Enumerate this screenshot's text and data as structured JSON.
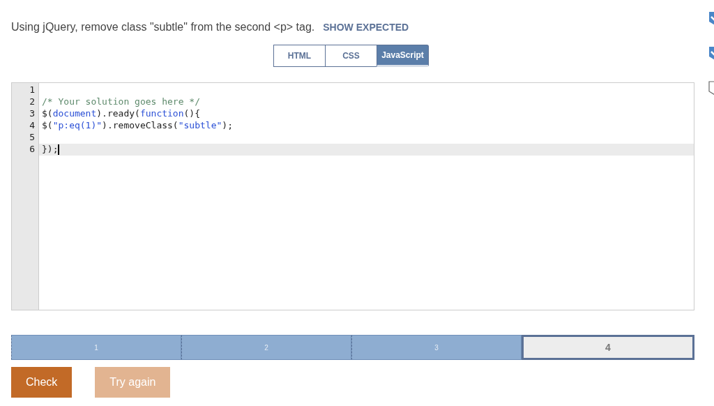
{
  "instruction": "Using jQuery, remove class \"subtle\" from the second <p> tag.",
  "show_expected": "SHOW EXPECTED",
  "tabs": [
    {
      "label": "HTML",
      "selected": false
    },
    {
      "label": "CSS",
      "selected": false
    },
    {
      "label": "JavaScript",
      "selected": true
    }
  ],
  "editor": {
    "lines": [
      {
        "number": "1",
        "current": false
      },
      {
        "number": "2",
        "current": false,
        "tokens": [
          {
            "text": "/* Your solution goes here */",
            "kind": "comment"
          }
        ]
      },
      {
        "number": "3",
        "current": false,
        "tokens": [
          {
            "text": "$(",
            "kind": "plain"
          },
          {
            "text": "document",
            "kind": "keyword"
          },
          {
            "text": ").ready(",
            "kind": "plain"
          },
          {
            "text": "function",
            "kind": "keyword"
          },
          {
            "text": "(){",
            "kind": "plain"
          }
        ]
      },
      {
        "number": "4",
        "current": false,
        "tokens": [
          {
            "text": "$(",
            "kind": "plain"
          },
          {
            "text": "\"p:eq(1)\"",
            "kind": "string"
          },
          {
            "text": ").removeClass(",
            "kind": "plain"
          },
          {
            "text": "\"subtle\"",
            "kind": "string"
          },
          {
            "text": ");",
            "kind": "plain"
          }
        ]
      },
      {
        "number": "5",
        "current": false
      },
      {
        "number": "6",
        "current": true,
        "tokens": [
          {
            "text": "});",
            "kind": "plain"
          }
        ]
      }
    ]
  },
  "progress": [
    {
      "label": "1",
      "completed": true,
      "selected": false
    },
    {
      "label": "2",
      "completed": true,
      "selected": false
    },
    {
      "label": "3",
      "completed": true,
      "selected": false
    },
    {
      "label": "4",
      "completed": false,
      "selected": true
    }
  ],
  "buttons": [
    {
      "label": "Check",
      "disabled": false
    },
    {
      "label": "Try again",
      "disabled": true
    }
  ],
  "side_badges": [
    {
      "checked": true
    },
    {
      "checked": true
    },
    {
      "checked": false
    }
  ]
}
